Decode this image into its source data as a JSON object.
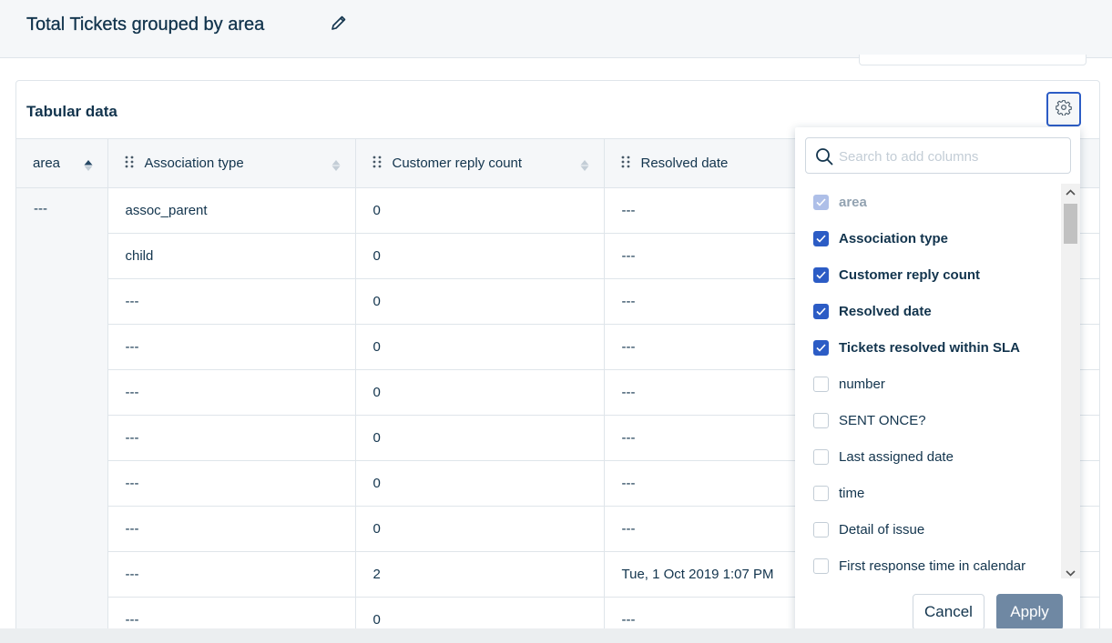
{
  "header": {
    "title": "Total Tickets grouped by area"
  },
  "card": {
    "title": "Tabular data"
  },
  "table": {
    "columns": [
      "area",
      "Association type",
      "Customer reply count",
      "Resolved date"
    ],
    "area_value": "---",
    "rows": [
      [
        "assoc_parent",
        "0",
        "---"
      ],
      [
        "child",
        "0",
        "---"
      ],
      [
        "---",
        "0",
        "---"
      ],
      [
        "---",
        "0",
        "---"
      ],
      [
        "---",
        "0",
        "---"
      ],
      [
        "---",
        "0",
        "---"
      ],
      [
        "---",
        "0",
        "---"
      ],
      [
        "---",
        "0",
        "---"
      ],
      [
        "---",
        "2",
        "Tue, 1 Oct 2019 1:07 PM"
      ],
      [
        "---",
        "0",
        "---"
      ]
    ]
  },
  "column_picker": {
    "search_placeholder": "Search to add columns",
    "options": [
      {
        "label": "area",
        "checked": true,
        "disabled": true
      },
      {
        "label": "Association type",
        "checked": true
      },
      {
        "label": "Customer reply count",
        "checked": true
      },
      {
        "label": "Resolved date",
        "checked": true
      },
      {
        "label": "Tickets resolved within SLA",
        "checked": true
      },
      {
        "label": "number",
        "checked": false
      },
      {
        "label": "SENT ONCE?",
        "checked": false
      },
      {
        "label": "Last assigned date",
        "checked": false
      },
      {
        "label": "time",
        "checked": false
      },
      {
        "label": "Detail of issue",
        "checked": false
      },
      {
        "label": "First response time in calendar",
        "checked": false
      }
    ],
    "cancel_label": "Cancel",
    "apply_label": "Apply"
  },
  "colors": {
    "accent": "#2c5cc5",
    "text": "#12344d",
    "apply_bg": "#6f88a3",
    "header_bg": "#f5f7f9"
  },
  "icons": {
    "edit": "pencil-icon",
    "settings": "gear-icon",
    "search": "search-icon",
    "drag": "drag-handle-icon",
    "sort": "sort-icon"
  }
}
